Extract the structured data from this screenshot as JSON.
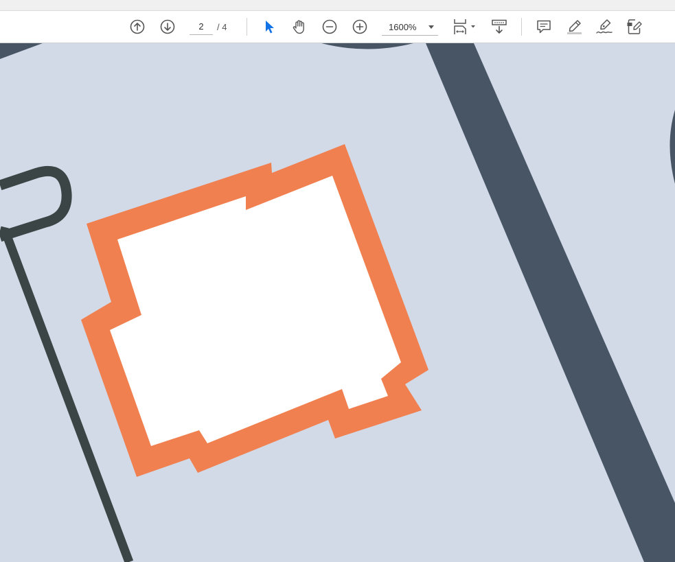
{
  "toolbar": {
    "page_current": "2",
    "page_total_label": "/ 4",
    "zoom_value": "1600%",
    "icons": [
      "arrow-up-circle-icon",
      "arrow-down-circle-icon",
      "select-arrow-icon",
      "hand-pan-icon",
      "zoom-out-icon",
      "zoom-in-icon",
      "fit-page-icon",
      "scroll-mode-icon",
      "comment-icon",
      "highlight-icon",
      "sign-icon",
      "edit-document-icon"
    ]
  },
  "colors": {
    "page_background": "#d2dae8",
    "orange_shape": "#f08050",
    "slate_band": "#475565",
    "dark_line": "#3b4546",
    "select_tool_active": "#1473e6"
  }
}
